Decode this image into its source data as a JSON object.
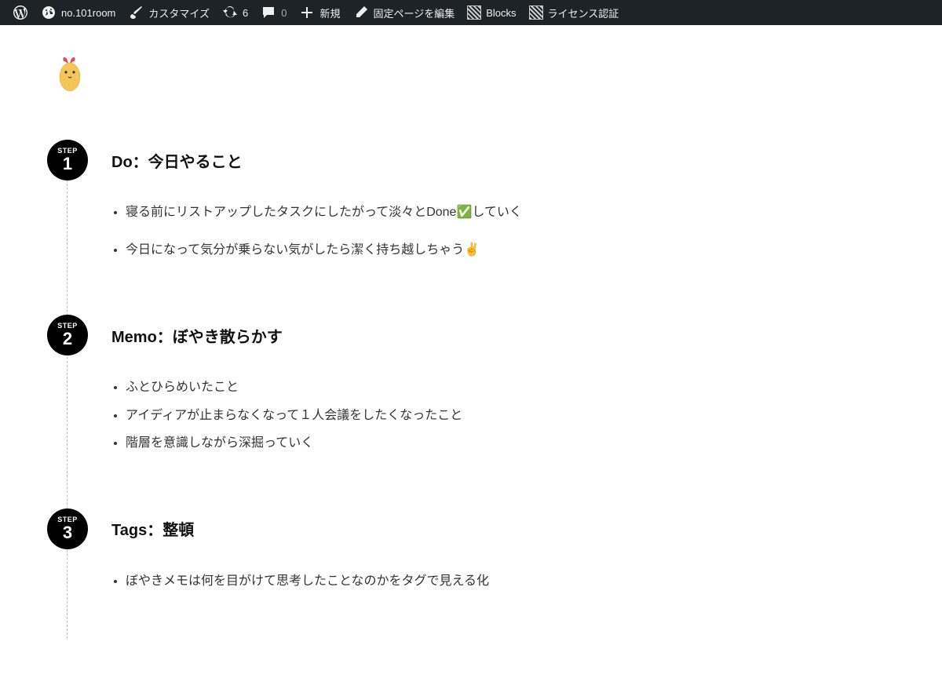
{
  "adminbar": {
    "site_name": "no.101room",
    "customize": "カスタマイズ",
    "updates_count": "6",
    "comments_count": "0",
    "new": "新規",
    "edit_page": "固定ページを編集",
    "blocks": "Blocks",
    "license": "ライセンス認証"
  },
  "steps": [
    {
      "badge_label": "STEP",
      "badge_num": "1",
      "title": "Do：今日やること",
      "items": [
        "寝る前にリストアップしたタスクにしたがって淡々とDone✅していく",
        "今日になって気分が乗らない気がしたら潔く持ち越しちゃう✌️"
      ],
      "compact": false
    },
    {
      "badge_label": "STEP",
      "badge_num": "2",
      "title": "Memo：ぼやき散らかす",
      "items": [
        "ふとひらめいたこと",
        "アイディアが止まらなくなって１人会議をしたくなったこと",
        "階層を意識しながら深掘っていく"
      ],
      "compact": true
    },
    {
      "badge_label": "STEP",
      "badge_num": "3",
      "title": "Tags：整頓",
      "items": [
        "ぼやきメモは何を目がけて思考したことなのかをタグで見える化"
      ],
      "compact": true
    }
  ]
}
